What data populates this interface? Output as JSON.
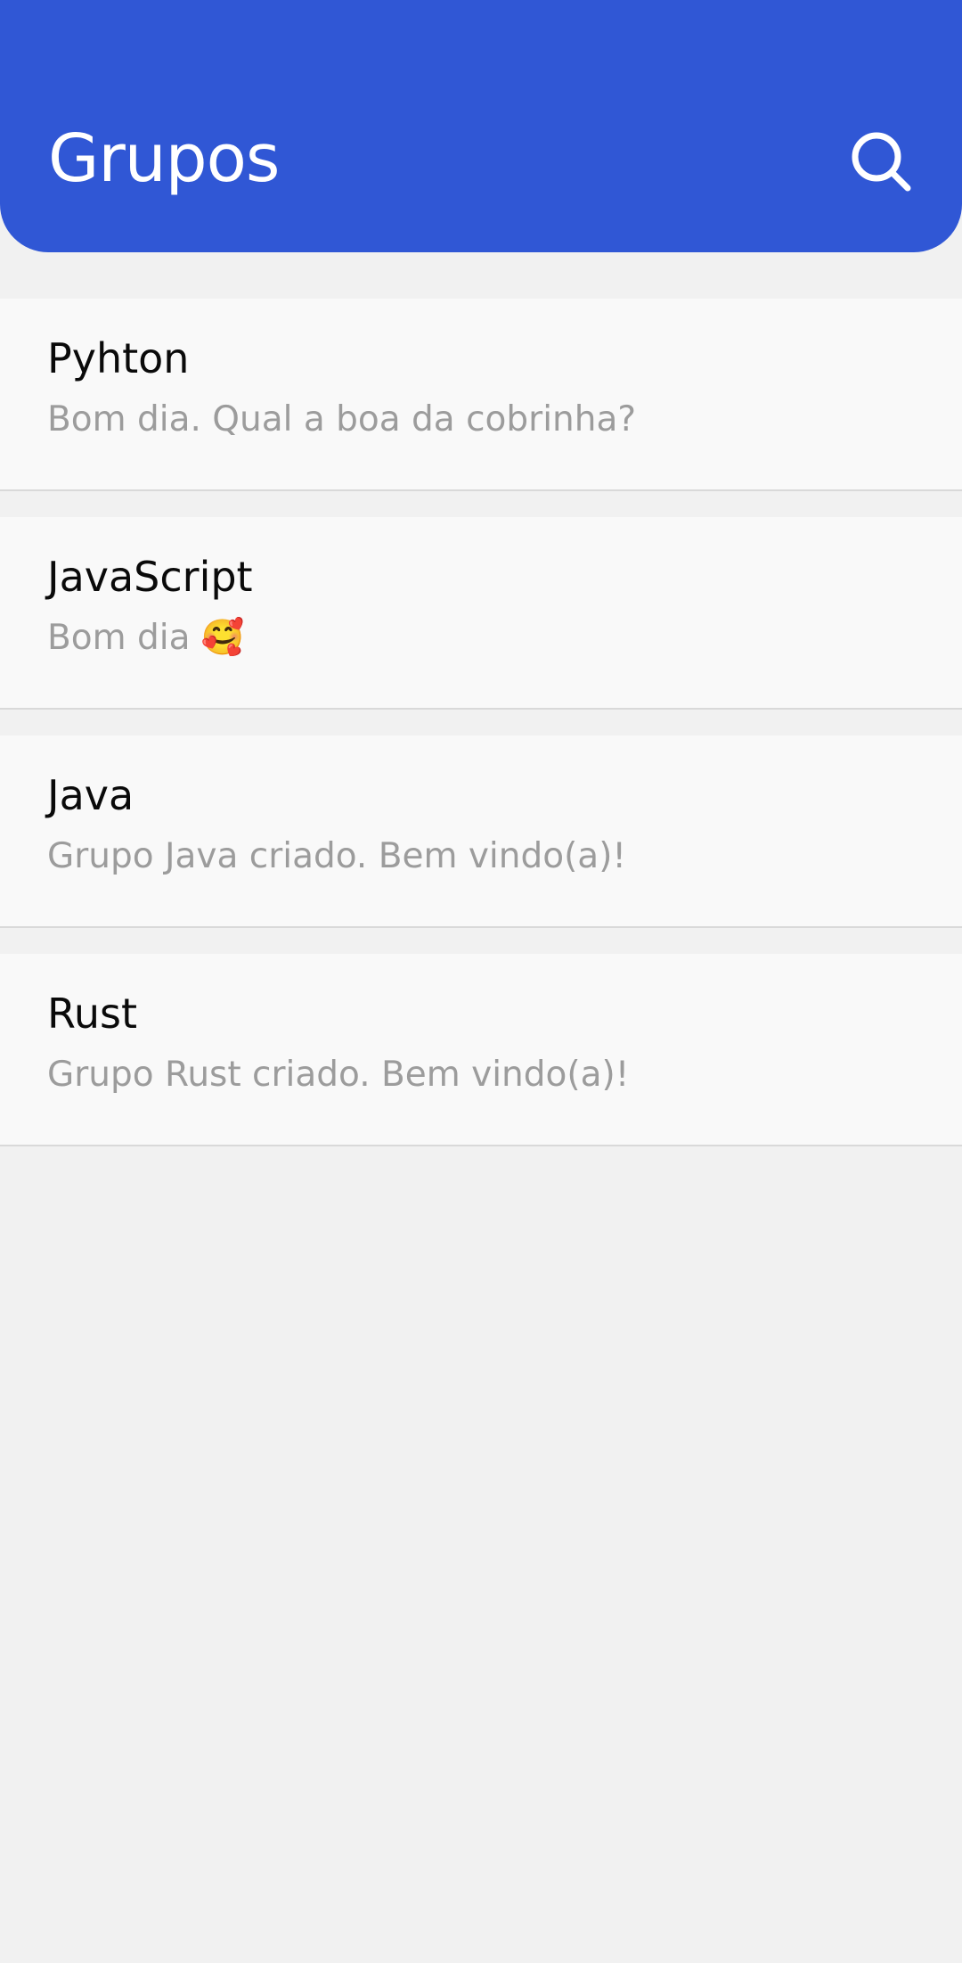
{
  "header": {
    "title": "Grupos",
    "search_icon": "search-icon",
    "color": "#3057d5"
  },
  "groups": [
    {
      "name": "Pyhton",
      "last_message": "Bom dia. Qual a boa da cobrinha?"
    },
    {
      "name": "JavaScript",
      "last_message": "Bom dia 🥰"
    },
    {
      "name": "Java",
      "last_message": "Grupo Java criado. Bem vindo(a)!"
    },
    {
      "name": "Rust",
      "last_message": "Grupo Rust criado. Bem vindo(a)!"
    }
  ]
}
